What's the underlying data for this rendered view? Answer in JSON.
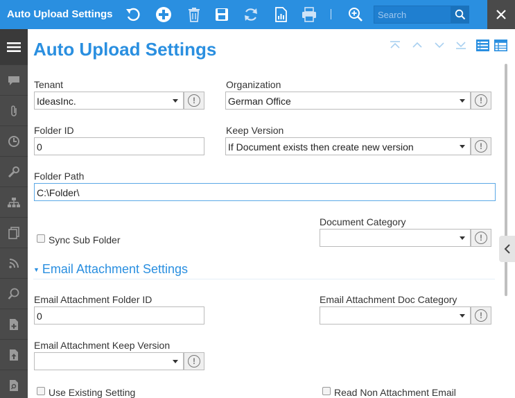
{
  "app": {
    "title": "Auto Upload Settings"
  },
  "toolbar": {
    "icons": [
      "undo-icon",
      "add-icon",
      "delete-icon",
      "save-icon",
      "refresh-icon",
      "report-icon",
      "print-icon",
      "zoom-icon"
    ],
    "search_placeholder": "Search"
  },
  "sidebar": {
    "icons": [
      "menu-icon",
      "chat-icon",
      "attachment-icon",
      "clock-icon",
      "wrench-icon",
      "org-chart-icon",
      "documents-icon",
      "feed-icon",
      "zoom-icon",
      "add-document-icon",
      "upload-document-icon",
      "search-document-icon"
    ]
  },
  "page": {
    "title": "Auto Upload Settings"
  },
  "form": {
    "tenant": {
      "label": "Tenant",
      "value": "IdeasInc."
    },
    "organization": {
      "label": "Organization",
      "value": "German Office"
    },
    "folder_id": {
      "label": "Folder ID",
      "value": "0"
    },
    "keep_version": {
      "label": "Keep Version",
      "value": "If Document exists then create new version"
    },
    "folder_path": {
      "label": "Folder Path",
      "value": "C:\\Folder\\"
    },
    "sync_sub_folder": {
      "label": "Sync Sub Folder",
      "checked": false
    },
    "document_category": {
      "label": "Document Category",
      "value": ""
    }
  },
  "email_section": {
    "title": "Email Attachment Settings",
    "folder_id": {
      "label": "Email Attachment Folder ID",
      "value": "0"
    },
    "doc_category": {
      "label": "Email Attachment Doc Category",
      "value": ""
    },
    "keep_version": {
      "label": "Email Attachment Keep Version",
      "value": ""
    },
    "use_existing": {
      "label": "Use Existing Setting",
      "checked": false
    },
    "read_non_attachment": {
      "label": "Read Non Attachment Email",
      "checked": false
    }
  },
  "info_symbol": "!",
  "colors": {
    "brand": "#2a8fe0",
    "sidebar": "#4a4a4a"
  }
}
